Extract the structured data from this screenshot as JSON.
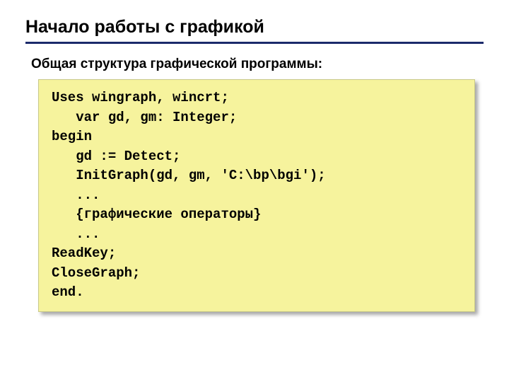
{
  "title": "Начало работы с графикой",
  "subtitle": "Общая структура графической программы:",
  "code": {
    "l1": "Uses wingraph, wincrt;",
    "l2": "   var gd, gm: Integer;",
    "l3": "begin",
    "l4": "   gd := Detect;",
    "l5": "   InitGraph(gd, gm, 'C:\\bp\\bgi');",
    "l6": "   ...",
    "l7": "   {графические операторы}",
    "l8": "   ...",
    "l9": "ReadKey;",
    "l10": "CloseGraph;",
    "l11": "end."
  }
}
